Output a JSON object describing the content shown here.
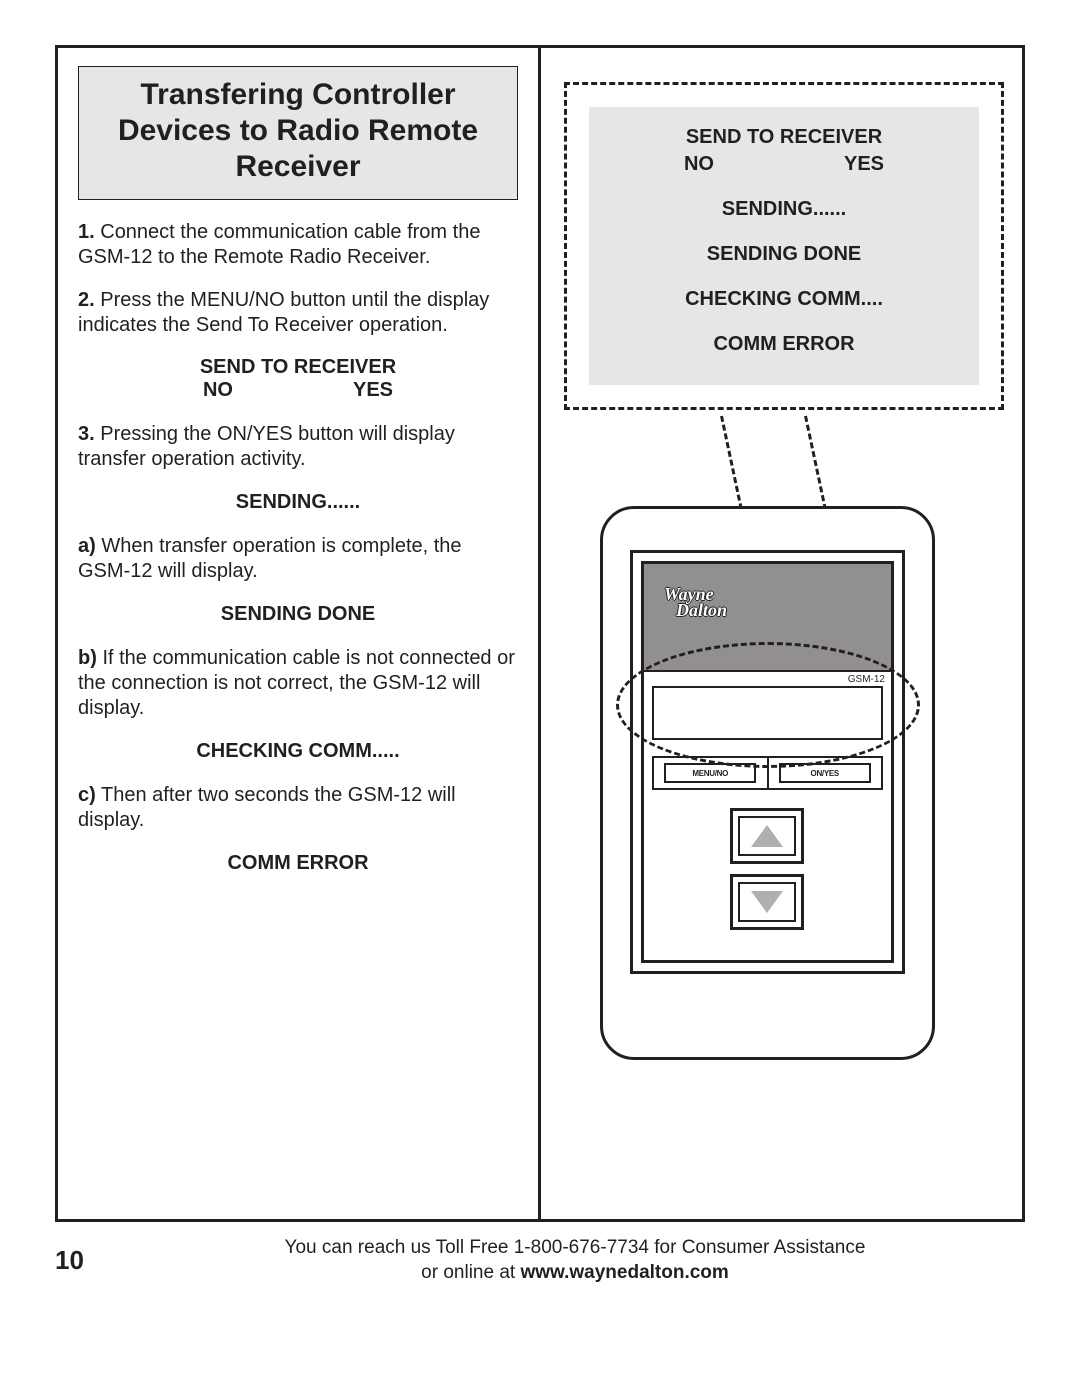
{
  "title": "Transfering Controller Devices to Radio Remote Receiver",
  "steps": {
    "s1_num": "1.",
    "s1_text": " Connect the communication cable from the GSM-12 to the Remote Radio Receiver.",
    "s2_num": "2.",
    "s2_text": " Press the MENU/NO button until the display indicates the Send To Receiver operation.",
    "s3_num": "3.",
    "s3_text": " Pressing the ON/YES button will display transfer operation activity.",
    "a_num": "a)",
    "a_text": " When transfer operation is complete, the GSM-12 will display.",
    "b_num": "b)",
    "b_text": " If the communication cable is not connected or the connection is not correct, the GSM-12 will display.",
    "c_num": "c)",
    "c_text": " Then after two seconds the GSM-12 will display."
  },
  "displays": {
    "send_to_receiver": "SEND TO RECEIVER",
    "no": "NO",
    "yes": "YES",
    "sending": "SENDING......",
    "sending_done": "SENDING DONE",
    "checking_comm_left": "CHECKING COMM.....",
    "checking_comm_right": "CHECKING COMM....",
    "comm_error": "COMM ERROR"
  },
  "device": {
    "logo_line1": "Wayne",
    "logo_line2": "Dalton",
    "model": "GSM-12",
    "btn_menu": "MENU/NO",
    "btn_on": "ON/YES"
  },
  "footer": {
    "page": "10",
    "line1": "You can reach us Toll Free 1-800-676-7734 for Consumer Assistance",
    "line2_pre": "or online at ",
    "url": "www.waynedalton.com"
  }
}
